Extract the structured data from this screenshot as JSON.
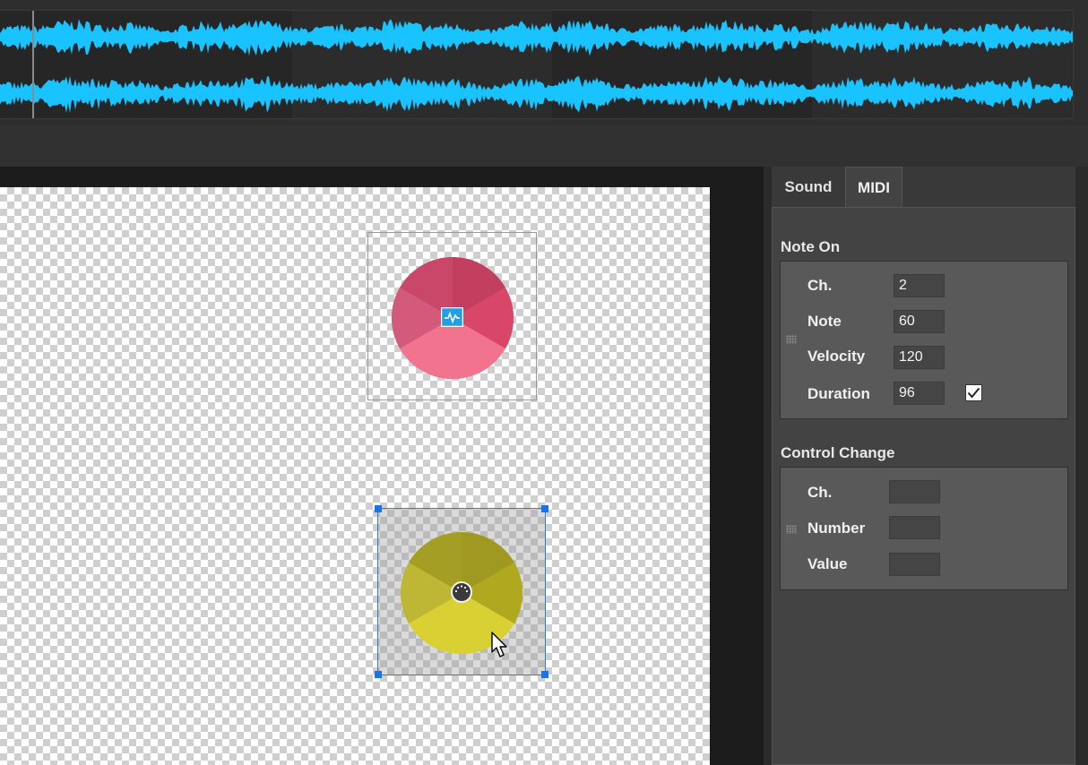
{
  "waveform": {
    "color": "#19c3ff",
    "channels": 2
  },
  "canvas": {
    "pads": [
      {
        "id": "sound-pad",
        "color": "#e0466a",
        "icon": "waveform-icon",
        "selected": false
      },
      {
        "id": "knob-pad",
        "color": "#c9c21c",
        "icon": "knob-icon",
        "selected": true
      }
    ],
    "accent": "#1a73e8"
  },
  "panel": {
    "tabs": [
      {
        "label": "Sound",
        "active": false
      },
      {
        "label": "MIDI",
        "active": true
      }
    ],
    "note_on": {
      "title": "Note On",
      "fields": [
        {
          "label": "Ch.",
          "value": "2"
        },
        {
          "label": "Note",
          "value": "60"
        },
        {
          "label": "Velocity",
          "value": "120"
        },
        {
          "label": "Duration",
          "value": "96"
        }
      ],
      "duration_checked": true
    },
    "control_change": {
      "title": "Control Change",
      "fields": [
        {
          "label": "Ch.",
          "value": ""
        },
        {
          "label": "Number",
          "value": ""
        },
        {
          "label": "Value",
          "value": ""
        }
      ]
    }
  }
}
